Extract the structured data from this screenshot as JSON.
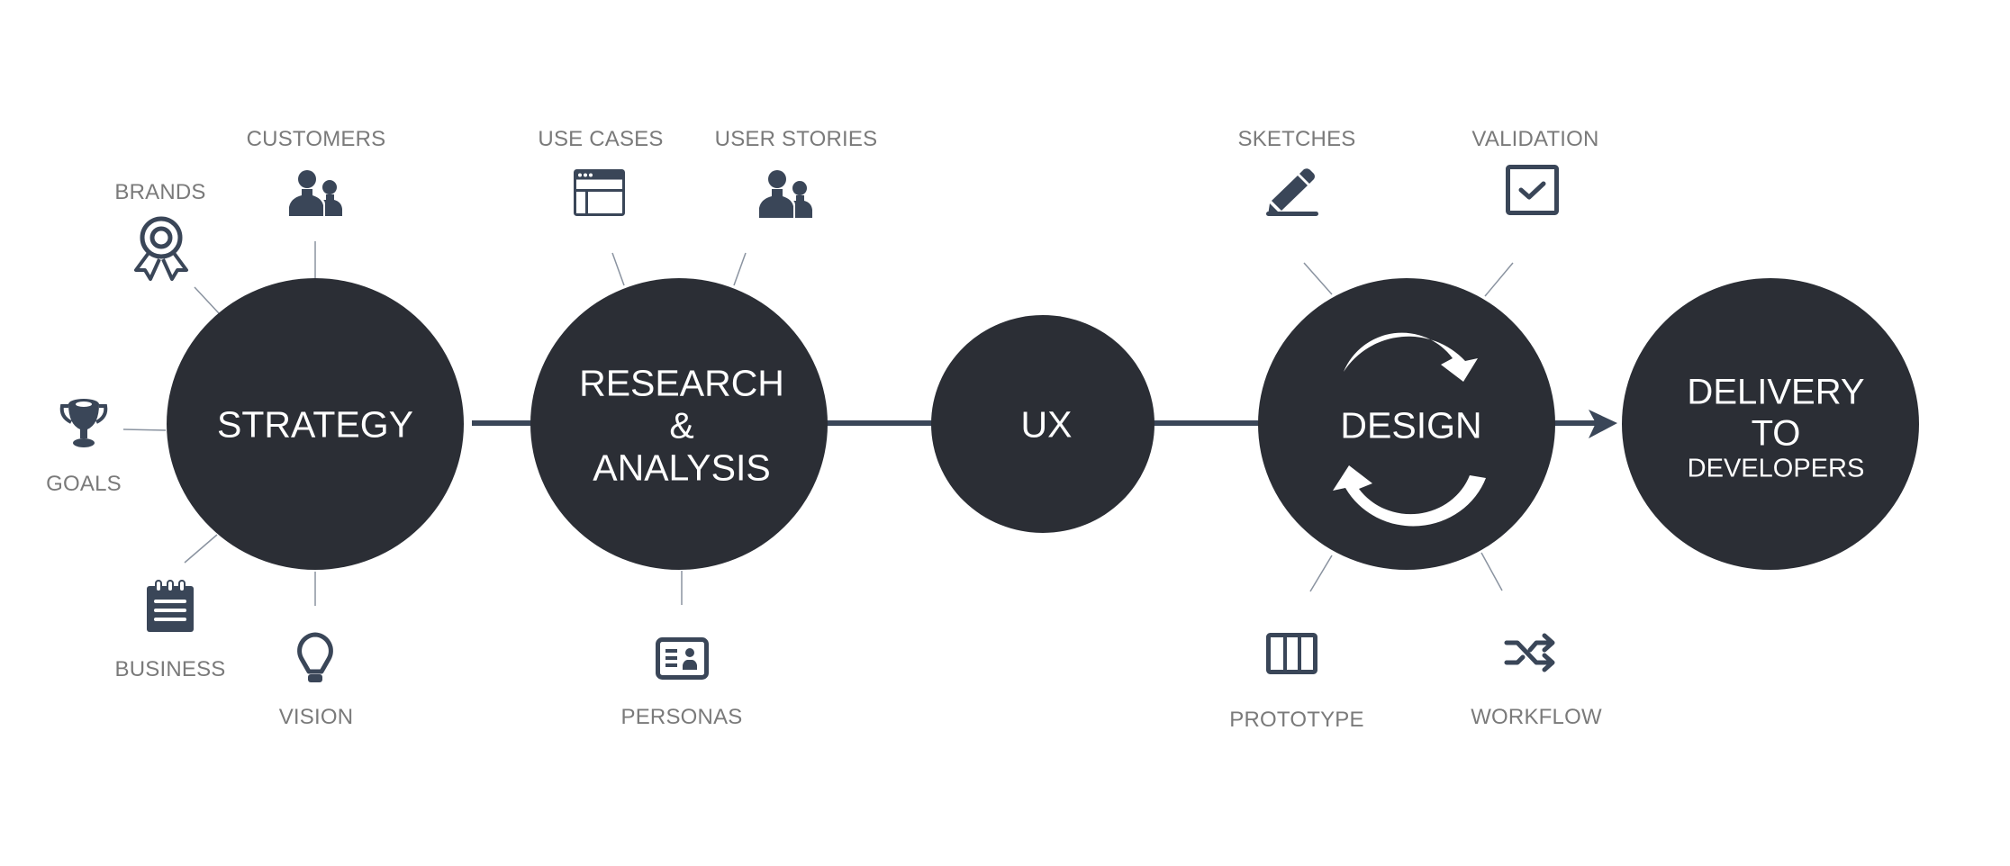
{
  "colors": {
    "node_fill": "#2b2e35",
    "connector": "#3a4658",
    "icon": "#3a4658",
    "spoke": "#8a93a0",
    "label": "#7a7a7a",
    "node_text": "#ffffff"
  },
  "stages": [
    {
      "id": "strategy",
      "lines": [
        "STRATEGY"
      ]
    },
    {
      "id": "research",
      "lines": [
        "RESEARCH",
        "&",
        "ANALYSIS"
      ]
    },
    {
      "id": "ux",
      "lines": [
        "UX"
      ]
    },
    {
      "id": "design",
      "lines": [
        "DESIGN"
      ],
      "icon": "refresh-cycle-icon"
    },
    {
      "id": "delivery",
      "lines": [
        "DELIVERY",
        "TO",
        "DEVELOPERS"
      ]
    }
  ],
  "satellites": {
    "strategy": [
      {
        "label": "CUSTOMERS",
        "icon": "users-icon"
      },
      {
        "label": "BRANDS",
        "icon": "award-ribbon-icon"
      },
      {
        "label": "GOALS",
        "icon": "trophy-icon"
      },
      {
        "label": "BUSINESS",
        "icon": "notepad-icon"
      },
      {
        "label": "VISION",
        "icon": "lightbulb-icon"
      }
    ],
    "research": [
      {
        "label": "USE CASES",
        "icon": "browser-window-icon"
      },
      {
        "label": "USER STORIES",
        "icon": "users-icon"
      },
      {
        "label": "PERSONAS",
        "icon": "id-card-icon"
      }
    ],
    "design": [
      {
        "label": "SKETCHES",
        "icon": "pencil-icon"
      },
      {
        "label": "VALIDATION",
        "icon": "checkbox-icon"
      },
      {
        "label": "PROTOTYPE",
        "icon": "columns-icon"
      },
      {
        "label": "WORKFLOW",
        "icon": "shuffle-icon"
      }
    ]
  }
}
